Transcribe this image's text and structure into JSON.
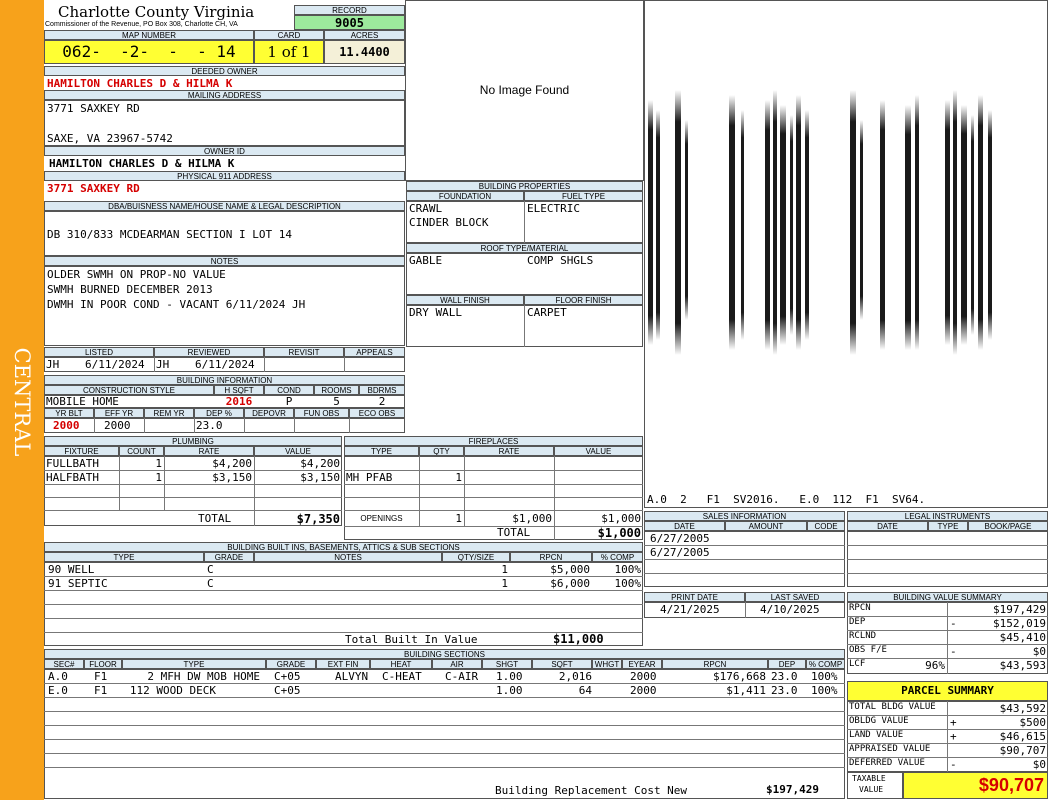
{
  "colors": {
    "orange": "#f7a21b",
    "header_bg": "#dbe9f2",
    "yellow": "#ffff33",
    "green": "#9dea9d",
    "red": "#d50000",
    "cream": "#f4f0d8"
  },
  "sidebar": {
    "label": "CENTRAL"
  },
  "county": {
    "title": "Charlotte County Virginia",
    "subtitle": "Commissioner of the Revenue, PO Box 308, Charlotte CH, VA"
  },
  "record": {
    "label": "RECORD",
    "value": "9005"
  },
  "map": {
    "label": "MAP NUMBER",
    "value": "062-  -2-  -  - 14"
  },
  "card": {
    "label": "CARD",
    "value": "1 of 1"
  },
  "acres": {
    "label": "ACRES",
    "value": "11.4400"
  },
  "owner": {
    "deeded_label": "DEEDED OWNER",
    "deeded_value": "HAMILTON CHARLES D & HILMA K",
    "mailing_label": "MAILING ADDRESS",
    "mailing_line1": "3771 SAXKEY RD",
    "mailing_line2": "SAXE, VA 23967-5742",
    "owner_id_label": "OWNER ID",
    "owner_id_value": "HAMILTON CHARLES D & HILMA K",
    "physical_label": "PHYSICAL 911 ADDRESS",
    "physical_value": "3771 SAXKEY RD"
  },
  "legal": {
    "label": "DBA/BUISNESS NAME/HOUSE NAME & LEGAL DESCRIPTION",
    "value": "DB 310/833 MCDEARMAN SECTION I LOT 14"
  },
  "notes": {
    "label": "NOTES",
    "lines": [
      "OLDER SWMH ON PROP-NO VALUE",
      "SWMH BURNED DECEMBER 2013",
      "DWMH IN POOR COND - VACANT 6/11/2024 JH"
    ]
  },
  "image": {
    "text": "No Image Found"
  },
  "building_properties": {
    "label": "BUILDING PROPERTIES",
    "foundation_label": "FOUNDATION",
    "foundation": [
      "CRAWL",
      "CINDER BLOCK"
    ],
    "fuel_label": "FUEL TYPE",
    "fuel": "ELECTRIC",
    "roof_label": "ROOF TYPE/MATERIAL",
    "roof_type": "GABLE",
    "roof_material": "COMP SHGLS",
    "wall_label": "WALL FINISH",
    "wall": "DRY WALL",
    "floor_label": "FLOOR FINISH",
    "floor": "CARPET"
  },
  "sketch": {
    "caption": "A.0  2   F1  SV2016.   E.0  112  F1  SV64."
  },
  "listing": {
    "listed_label": "LISTED",
    "listed_by": "JH",
    "listed_date": "6/11/2024",
    "reviewed_label": "REVIEWED",
    "reviewed_by": "JH",
    "reviewed_date": "6/11/2024",
    "revisit_label": "REVISIT",
    "appeals_label": "APPEALS"
  },
  "building_info": {
    "label": "BUILDING INFORMATION",
    "style_label": "CONSTRUCTION STYLE",
    "style": "MOBILE HOME",
    "hsqft_label": "H SQFT",
    "hsqft": "2016",
    "cond_label": "COND",
    "cond": "P",
    "rooms_label": "ROOMS",
    "rooms": "5",
    "bdrms_label": "BDRMS",
    "bdrms": "2",
    "yrblt_label": "YR BLT",
    "yrblt": "2000",
    "effyr_label": "EFF YR",
    "effyr": "2000",
    "remyr_label": "REM YR",
    "dep_label": "DEP %",
    "dep": "23.0",
    "depovr_label": "DEPOVR",
    "funobs_label": "FUN OBS",
    "ecoobs_label": "ECO OBS"
  },
  "plumbing": {
    "label": "PLUMBING",
    "headers": [
      "FIXTURE",
      "COUNT",
      "RATE",
      "VALUE"
    ],
    "rows": [
      [
        "FULLBATH",
        "1",
        "$4,200",
        "$4,200"
      ],
      [
        "HALFBATH",
        "1",
        "$3,150",
        "$3,150"
      ]
    ],
    "total_label": "TOTAL",
    "total": "$7,350"
  },
  "fireplaces": {
    "label": "FIREPLACES",
    "headers": [
      "TYPE",
      "QTY",
      "RATE",
      "VALUE"
    ],
    "rows": [
      [
        "MH PFAB",
        "1",
        "",
        ""
      ]
    ],
    "openings_label": "OPENINGS",
    "openings_qty": "1",
    "openings_rate": "$1,000",
    "openings_value": "$1,000",
    "total_label": "TOTAL",
    "total": "$1,000"
  },
  "sales": {
    "label": "SALES INFORMATION",
    "headers": [
      "DATE",
      "AMOUNT",
      "CODE"
    ],
    "rows": [
      "6/27/2005",
      "6/27/2005"
    ]
  },
  "legal_instruments": {
    "label": "LEGAL INSTRUMENTS",
    "headers": [
      "DATE",
      "TYPE",
      "BOOK/PAGE"
    ]
  },
  "print": {
    "print_label": "PRINT DATE",
    "print_date": "4/21/2025",
    "saved_label": "LAST SAVED",
    "saved_date": "4/10/2025"
  },
  "builtins": {
    "label": "BUILDING BUILT INS, BASEMENTS, ATTICS & SUB SECTIONS",
    "headers": [
      "TYPE",
      "GRADE",
      "NOTES",
      "QTY/SIZE",
      "RPCN",
      "% COMP"
    ],
    "rows": [
      [
        "90 WELL",
        "C",
        "",
        "1",
        "$5,000",
        "100%"
      ],
      [
        "91 SEPTIC",
        "C",
        "",
        "1",
        "$6,000",
        "100%"
      ]
    ],
    "total_label": "Total Built In Value",
    "total": "$11,000"
  },
  "sections": {
    "label": "BUILDING SECTIONS",
    "headers": [
      "SEC#",
      "FLOOR",
      "TYPE",
      "GRADE",
      "EXT FIN",
      "HEAT",
      "AIR",
      "SHGT",
      "SQFT",
      "WHGT",
      "EYEAR",
      "RPCN",
      "DEP",
      "% COMP"
    ],
    "rows": [
      [
        "A.0",
        "F1",
        "2 MFH DW MOB HOME",
        "C+05",
        "ALVYN",
        "C-HEAT",
        "C-AIR",
        "1.00",
        "2,016",
        "",
        "2000",
        "$176,668",
        "23.0",
        "100%"
      ],
      [
        "E.0",
        "F1",
        "112 WOOD DECK",
        "C+05",
        "",
        "",
        "",
        "1.00",
        "64",
        "",
        "2000",
        "$1,411",
        "23.0",
        "100%"
      ]
    ],
    "total_label": "Building Replacement Cost New",
    "total": "$197,429"
  },
  "value_summary": {
    "label": "BUILDING VALUE SUMMARY",
    "rows": [
      [
        "RPCN",
        "",
        "$197,429"
      ],
      [
        "DEP",
        "-",
        "$152,019"
      ],
      [
        "RCLND",
        "",
        "$45,410"
      ],
      [
        "OBS F/E",
        "-",
        "$0"
      ],
      [
        "LCF",
        "96%",
        "$43,593"
      ]
    ]
  },
  "parcel": {
    "label": "PARCEL SUMMARY",
    "rows": [
      [
        "TOTAL BLDG VALUE",
        "",
        "$43,592"
      ],
      [
        "OBLDG VALUE",
        "+",
        "$500"
      ],
      [
        "LAND VALUE",
        "+",
        "$46,615"
      ],
      [
        "APPRAISED VALUE",
        "",
        "$90,707"
      ],
      [
        "DEFERRED VALUE",
        "-",
        "$0"
      ]
    ],
    "taxable_label_1": "TAXABLE",
    "taxable_label_2": "VALUE",
    "taxable_value": "$90,707"
  }
}
